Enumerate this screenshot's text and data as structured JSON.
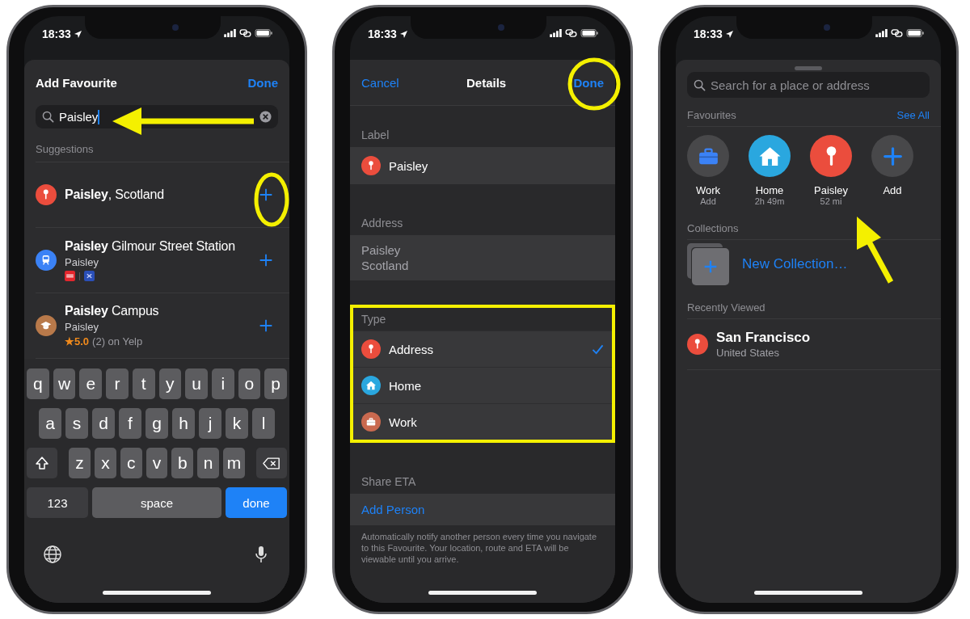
{
  "add_favourite_screen": {
    "status_time": "18:33",
    "title": "Add Favourite",
    "done": "Done",
    "search_value": "Paisley",
    "section_header": "Suggestions",
    "suggestions": [
      {
        "kind": "pin",
        "title": "**Paisley**, Scotland"
      },
      {
        "kind": "station",
        "title": "**Paisley** Gilmour Street Station",
        "subtitle": "Paisley"
      },
      {
        "kind": "campus",
        "title": "**Paisley** Campus",
        "subtitle": "Paisley",
        "rating": "★5.0",
        "reviews": "(2) on Yelp"
      }
    ],
    "keyboard": {
      "rows": [
        [
          "q",
          "w",
          "e",
          "r",
          "t",
          "y",
          "u",
          "i",
          "o",
          "p"
        ],
        [
          "a",
          "s",
          "d",
          "f",
          "g",
          "h",
          "j",
          "k",
          "l"
        ],
        [
          "z",
          "x",
          "c",
          "v",
          "b",
          "n",
          "m"
        ]
      ],
      "numbers_key": "123",
      "space_key": "space",
      "return_key": "done"
    }
  },
  "details_screen": {
    "status_time": "18:33",
    "cancel": "Cancel",
    "title": "Details",
    "done": "Done",
    "label_section": {
      "header": "Label",
      "value": "Paisley"
    },
    "address_section": {
      "header": "Address",
      "lines": [
        "Paisley",
        "Scotland"
      ]
    },
    "type_section": {
      "header": "Type",
      "options": [
        {
          "kind": "pin",
          "label": "Address",
          "selected": true
        },
        {
          "kind": "home",
          "label": "Home",
          "selected": false
        },
        {
          "kind": "work",
          "label": "Work",
          "selected": false
        }
      ]
    },
    "share_section": {
      "header": "Share ETA",
      "action": "Add Person",
      "footnote": "Automatically notify another person every time you navigate to this Favourite. Your location, route and ETA will be viewable until you arrive."
    }
  },
  "maps_home_screen": {
    "status_time": "18:33",
    "search_placeholder": "Search for a place or address",
    "favourites_header": "Favourites",
    "see_all": "See All",
    "favourites": [
      {
        "kind": "work",
        "name": "Work",
        "detail": "Add"
      },
      {
        "kind": "home",
        "name": "Home",
        "detail": "2h 49m"
      },
      {
        "kind": "pin",
        "name": "Paisley",
        "detail": "52 mi"
      },
      {
        "kind": "add",
        "name": "Add"
      }
    ],
    "collections_header": "Collections",
    "new_collection": "New Collection…",
    "recent_header": "Recently Viewed",
    "recent": [
      {
        "kind": "pin",
        "title": "San Francisco",
        "subtitle": "United States"
      }
    ]
  }
}
